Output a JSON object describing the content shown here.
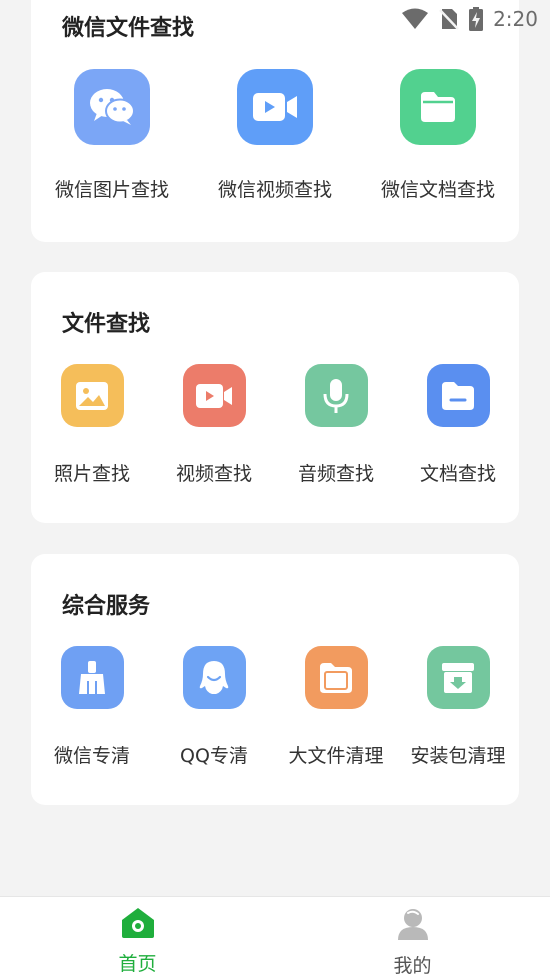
{
  "status_bar": {
    "time": "2:20"
  },
  "wechat_section": {
    "title": "微信文件查找",
    "items": [
      {
        "label": "微信图片查找",
        "icon": "wechat-chat-icon",
        "color": "#7ba6f6"
      },
      {
        "label": "微信视频查找",
        "icon": "video-camera-icon",
        "color": "#5f9ef8"
      },
      {
        "label": "微信文档查找",
        "icon": "folder-icon",
        "color": "#52d18f"
      }
    ]
  },
  "file_section": {
    "title": "文件查找",
    "items": [
      {
        "label": "照片查找",
        "icon": "image-icon",
        "color": "#f5be5a"
      },
      {
        "label": "视频查找",
        "icon": "video-camera-icon",
        "color": "#ec7c6a"
      },
      {
        "label": "音频查找",
        "icon": "microphone-icon",
        "color": "#75c79f"
      },
      {
        "label": "文档查找",
        "icon": "folder-icon",
        "color": "#5a8ff0"
      }
    ]
  },
  "service_section": {
    "title": "综合服务",
    "items": [
      {
        "label": "微信专清",
        "icon": "broom-icon",
        "color": "#6fa0f3"
      },
      {
        "label": "QQ专清",
        "icon": "qq-penguin-icon",
        "color": "#6ea3f4"
      },
      {
        "label": "大文件清理",
        "icon": "files-icon",
        "color": "#f29b5f"
      },
      {
        "label": "安装包清理",
        "icon": "package-download-icon",
        "color": "#74c79e"
      }
    ]
  },
  "bottom_nav": {
    "home_label": "首页",
    "mine_label": "我的",
    "active_color": "#1fae3c"
  }
}
